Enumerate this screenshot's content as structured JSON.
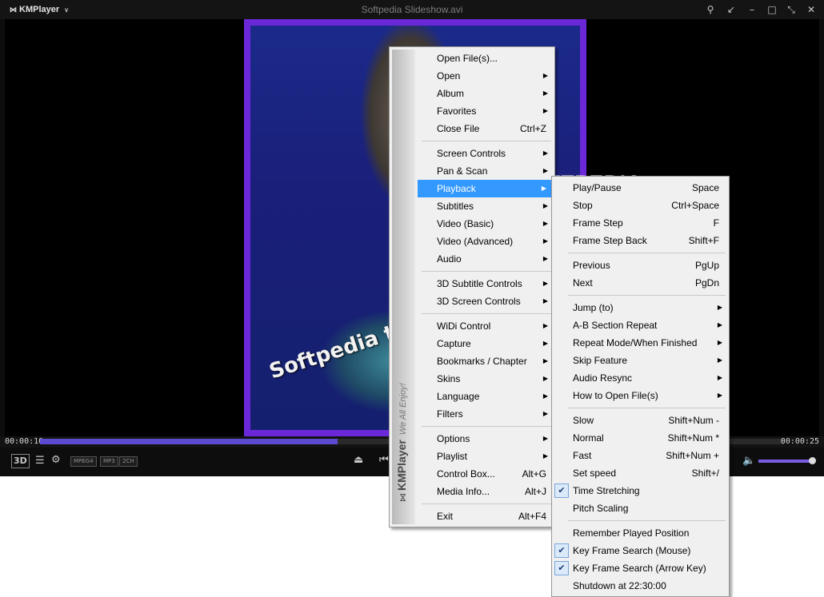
{
  "window": {
    "app_name": "KMPlayer",
    "title": "Softpedia Slideshow.avi",
    "controls": {
      "pin": "pin-icon",
      "minimize_to": "arrow-down-left-icon",
      "minimize": "minimize-icon",
      "maximize": "maximize-icon",
      "fullscreen": "fullscreen-icon",
      "close": "close-icon"
    }
  },
  "video": {
    "overlay_text": "Softpedia test",
    "watermark": "SOFTPEDIA"
  },
  "playback": {
    "current_time": "00:00:10",
    "total_time": "00:00:25",
    "progress_fraction": 0.4
  },
  "controls": {
    "badges": [
      "MPEG4",
      "MP3",
      "2CH"
    ],
    "volume_fraction": 0.95
  },
  "main_menu": {
    "brand": "KMPlayer",
    "tagline": "We All Enjoy!",
    "items": [
      {
        "label": "Open File(s)...",
        "shortcut": "",
        "submenu": false
      },
      {
        "label": "Open",
        "shortcut": "",
        "submenu": true
      },
      {
        "label": "Album",
        "shortcut": "",
        "submenu": true
      },
      {
        "label": "Favorites",
        "shortcut": "",
        "submenu": true
      },
      {
        "label": "Close File",
        "shortcut": "Ctrl+Z",
        "submenu": false
      },
      {
        "label": "Screen Controls",
        "shortcut": "",
        "submenu": true
      },
      {
        "label": "Pan & Scan",
        "shortcut": "",
        "submenu": true
      },
      {
        "label": "Playback",
        "shortcut": "",
        "submenu": true
      },
      {
        "label": "Subtitles",
        "shortcut": "",
        "submenu": true
      },
      {
        "label": "Video (Basic)",
        "shortcut": "",
        "submenu": true
      },
      {
        "label": "Video (Advanced)",
        "shortcut": "",
        "submenu": true
      },
      {
        "label": "Audio",
        "shortcut": "",
        "submenu": true
      },
      {
        "label": "3D Subtitle Controls",
        "shortcut": "",
        "submenu": true
      },
      {
        "label": "3D Screen Controls",
        "shortcut": "",
        "submenu": true
      },
      {
        "label": "WiDi Control",
        "shortcut": "",
        "submenu": true
      },
      {
        "label": "Capture",
        "shortcut": "",
        "submenu": true
      },
      {
        "label": "Bookmarks / Chapter",
        "shortcut": "",
        "submenu": true
      },
      {
        "label": "Skins",
        "shortcut": "",
        "submenu": true
      },
      {
        "label": "Language",
        "shortcut": "",
        "submenu": true
      },
      {
        "label": "Filters",
        "shortcut": "",
        "submenu": true
      },
      {
        "label": "Options",
        "shortcut": "",
        "submenu": true
      },
      {
        "label": "Playlist",
        "shortcut": "",
        "submenu": true
      },
      {
        "label": "Control Box...",
        "shortcut": "Alt+G",
        "submenu": false
      },
      {
        "label": "Media Info...",
        "shortcut": "Alt+J",
        "submenu": false
      },
      {
        "label": "Exit",
        "shortcut": "Alt+F4",
        "submenu": false
      }
    ]
  },
  "playback_menu": {
    "items": [
      {
        "label": "Play/Pause",
        "shortcut": "Space",
        "submenu": false,
        "checked": false
      },
      {
        "label": "Stop",
        "shortcut": "Ctrl+Space",
        "submenu": false,
        "checked": false
      },
      {
        "label": "Frame Step",
        "shortcut": "F",
        "submenu": false,
        "checked": false
      },
      {
        "label": "Frame Step Back",
        "shortcut": "Shift+F",
        "submenu": false,
        "checked": false
      },
      {
        "label": "Previous",
        "shortcut": "PgUp",
        "submenu": false,
        "checked": false
      },
      {
        "label": "Next",
        "shortcut": "PgDn",
        "submenu": false,
        "checked": false
      },
      {
        "label": "Jump (to)",
        "shortcut": "",
        "submenu": true,
        "checked": false
      },
      {
        "label": "A-B Section Repeat",
        "shortcut": "",
        "submenu": true,
        "checked": false
      },
      {
        "label": "Repeat Mode/When Finished",
        "shortcut": "",
        "submenu": true,
        "checked": false
      },
      {
        "label": "Skip Feature",
        "shortcut": "",
        "submenu": true,
        "checked": false
      },
      {
        "label": "Audio Resync",
        "shortcut": "",
        "submenu": true,
        "checked": false
      },
      {
        "label": "How to Open File(s)",
        "shortcut": "",
        "submenu": true,
        "checked": false
      },
      {
        "label": "Slow",
        "shortcut": "Shift+Num -",
        "submenu": false,
        "checked": false
      },
      {
        "label": "Normal",
        "shortcut": "Shift+Num *",
        "submenu": false,
        "checked": false
      },
      {
        "label": "Fast",
        "shortcut": "Shift+Num +",
        "submenu": false,
        "checked": false
      },
      {
        "label": "Set speed",
        "shortcut": "Shift+/",
        "submenu": false,
        "checked": false
      },
      {
        "label": "Time Stretching",
        "shortcut": "",
        "submenu": false,
        "checked": true
      },
      {
        "label": "Pitch Scaling",
        "shortcut": "",
        "submenu": false,
        "checked": false
      },
      {
        "label": "Remember Played Position",
        "shortcut": "",
        "submenu": false,
        "checked": false
      },
      {
        "label": "Key Frame Search (Mouse)",
        "shortcut": "",
        "submenu": false,
        "checked": true
      },
      {
        "label": "Key Frame Search (Arrow Key)",
        "shortcut": "",
        "submenu": false,
        "checked": true
      },
      {
        "label": "Shutdown at 22:30:00",
        "shortcut": "",
        "submenu": false,
        "checked": false
      }
    ]
  },
  "colors": {
    "highlight": "#3399ff",
    "frame_border": "#6a28d8",
    "progress": "#5b4bd0"
  }
}
